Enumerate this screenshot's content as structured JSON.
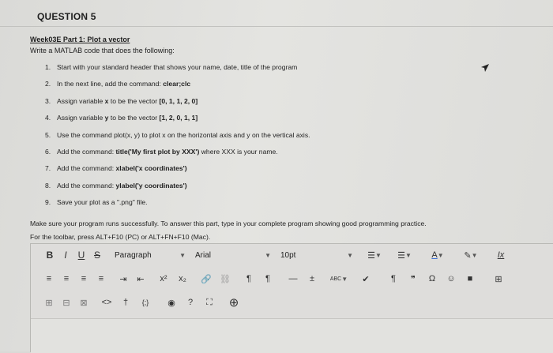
{
  "question": {
    "title": "QUESTION 5"
  },
  "assignment": {
    "heading": "Week03E Part 1: Plot a vector",
    "intro": "Write a MATLAB code that does the following:",
    "steps": [
      {
        "num": "1.",
        "text": "Start with your standard header that shows your name, date, title of the program"
      },
      {
        "num": "2.",
        "pre": "In the next line, add the command: ",
        "bold": "clear;clc",
        "post": ""
      },
      {
        "num": "3.",
        "pre": "Assign variable ",
        "bold": "x",
        "post": " to be the vector ",
        "bold2": "[0, 1, 1, 2, 0]"
      },
      {
        "num": "4.",
        "pre": "Assign variable ",
        "bold": "y",
        "post": " to be the vector ",
        "bold2": "[1, 2, 0, 1, 1]"
      },
      {
        "num": "5.",
        "text": "Use the command plot(x, y) to plot x on the horizontal axis and y on the vertical axis."
      },
      {
        "num": "6.",
        "pre": "Add the command: ",
        "bold": "title('My first plot by XXX')",
        "post": " where XXX is your name."
      },
      {
        "num": "7.",
        "pre": "Add the command: ",
        "bold": "xlabel('x coordinates')",
        "post": ""
      },
      {
        "num": "8.",
        "pre": "Add the command: ",
        "bold": "ylabel('y coordinates')",
        "post": ""
      },
      {
        "num": "9.",
        "text": "Save your plot as a \".png\" file."
      }
    ],
    "instructions": "Make sure your program runs successfully. To answer this part, type in your complete program showing good programming practice.",
    "toolbar_hint": "For the toolbar, press ALT+F10 (PC) or ALT+FN+F10 (Mac)."
  },
  "editor": {
    "format_select": "Paragraph",
    "font_select": "Arial",
    "size_select": "10pt",
    "icons": {
      "bold": "B",
      "italic": "I",
      "underline": "U",
      "strike": "S",
      "list_bullets": "☰",
      "list_numbers": "☰",
      "font_color": "A",
      "highlight": "✎",
      "clear_format": "Ix",
      "superscript": "x²",
      "subscript": "x₂",
      "link": "🔗",
      "unlink": "⛓",
      "ltr": "¶",
      "rtl": "¶",
      "hr": "—",
      "plus_minus": "±",
      "spell": "ABC",
      "check": "✔",
      "pilcrow": "¶",
      "quote": "❞",
      "omega": "Ω",
      "emoji": "☺",
      "bookmark": "■",
      "table": "⊞",
      "code": "<>",
      "accessibility": "†",
      "braces": "{;}",
      "preview": "◉",
      "help": "?",
      "fullscreen": "⛶",
      "add": "⊕"
    },
    "accent_color": "#3a6fd8"
  }
}
